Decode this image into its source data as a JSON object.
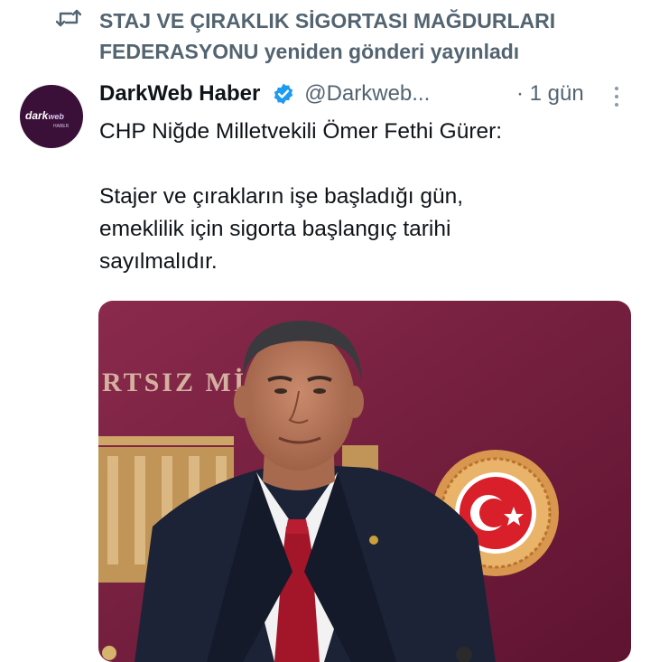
{
  "repost": {
    "icon": "repost-icon",
    "text": "STAJ VE ÇIRAKLIK SİGORTASI MAĞDURLARI FEDERASYONU yeniden gönderi yayınladı"
  },
  "tweet": {
    "avatar_logo": "dark",
    "avatar_logo_w": "web",
    "avatar_sub": "HABER",
    "author_name": "DarkWeb Haber",
    "verified_icon": "verified-badge-icon",
    "handle": "@Darkweb...",
    "time": "· 1 gün",
    "more_icon": "more-icon",
    "text": "CHP Niğde Milletvekili Ömer Fethi Gürer:\n\nStajer ve çırakların işe başladığı gün,\nemeklilik için sigorta başlangıç tarihi\nsayılmalıdır.",
    "photo_wall_text": "RTSIZ Mİ"
  },
  "colors": {
    "accent_blue": "#1d9bf0",
    "muted": "#536471",
    "parliament_wall": "#7a1f3f"
  }
}
